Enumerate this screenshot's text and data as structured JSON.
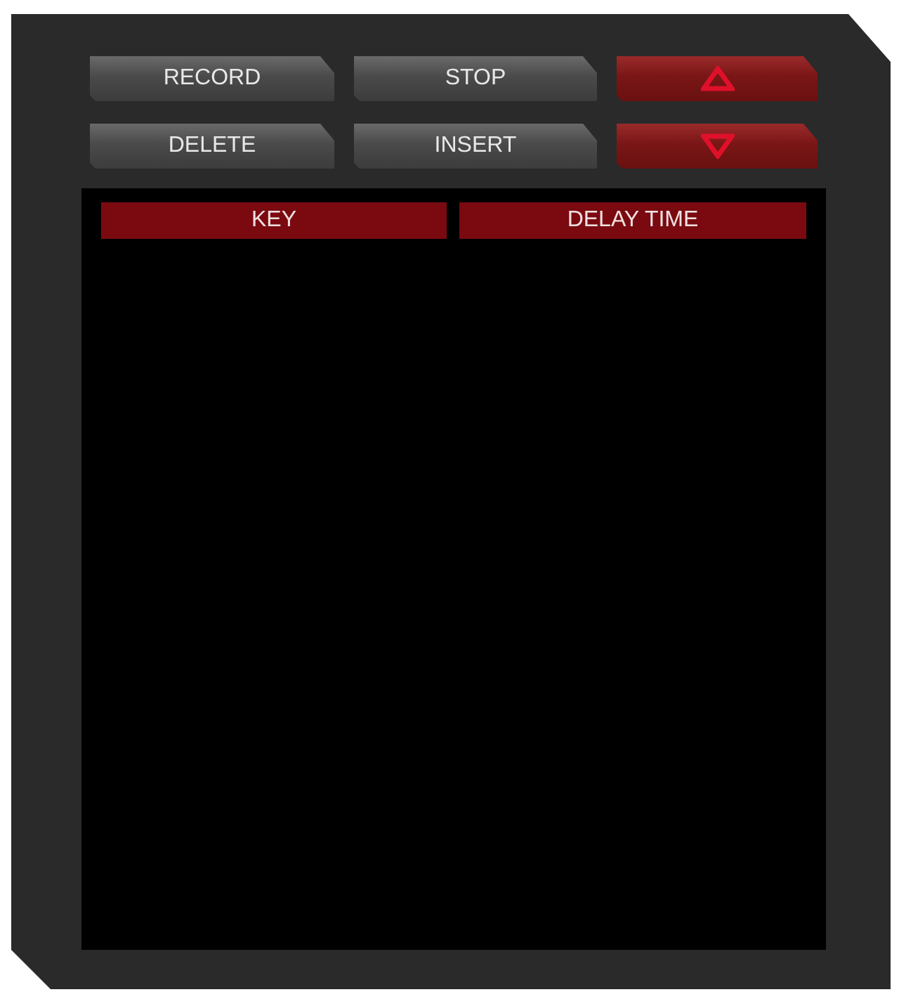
{
  "buttons": [
    {
      "kind": "text",
      "label": "RECORD"
    },
    {
      "kind": "text",
      "label": "STOP"
    },
    {
      "kind": "up"
    },
    {
      "kind": "text",
      "label": "DELETE"
    },
    {
      "kind": "text",
      "label": "INSERT"
    },
    {
      "kind": "down"
    }
  ],
  "table": {
    "columns": [
      "KEY",
      "DELAY TIME"
    ]
  }
}
